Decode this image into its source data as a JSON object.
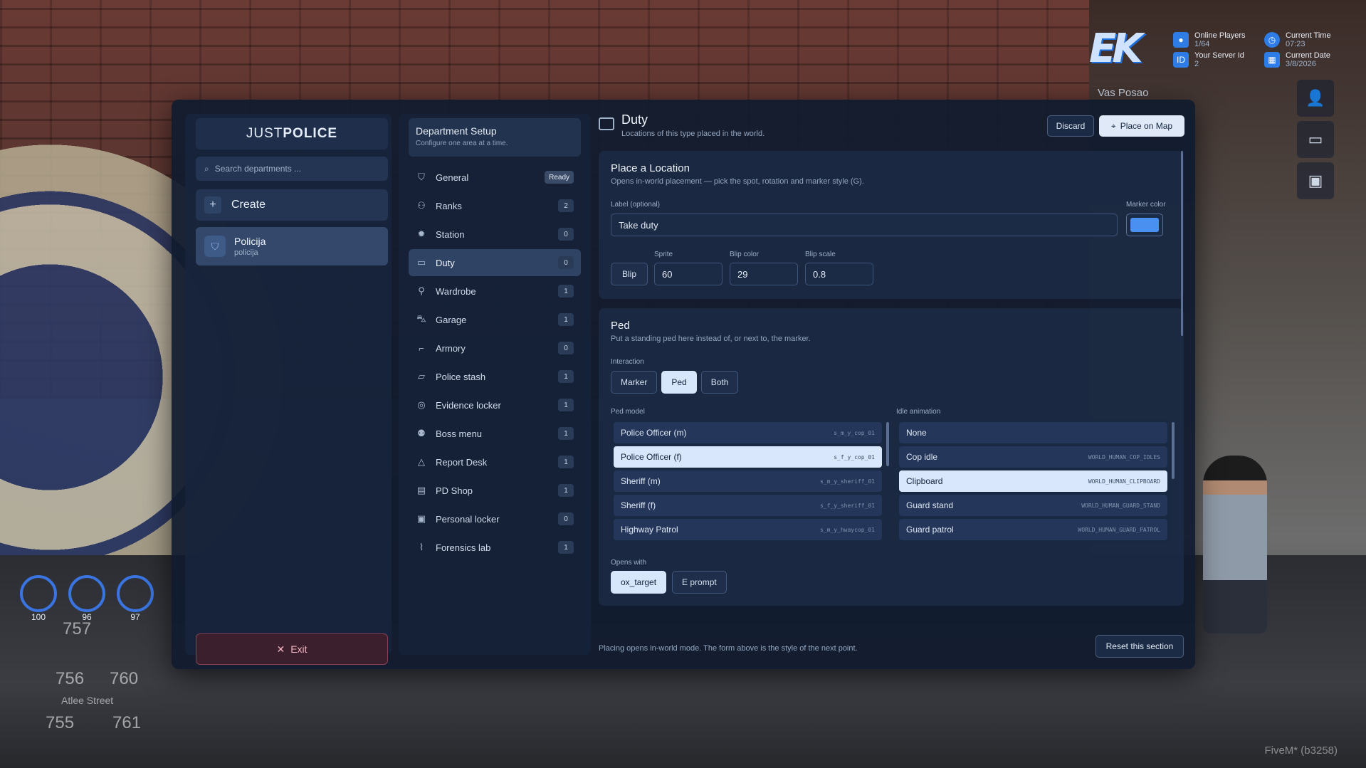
{
  "hud": {
    "online_label": "Online Players",
    "online_value": "1/64",
    "server_id_label": "Your Server Id",
    "server_id_value": "2",
    "time_label": "Current Time",
    "time_value": "07:23",
    "date_label": "Current Date",
    "date_value": "3/8/2026",
    "player_name": "Vas Posao"
  },
  "gauges": [
    "100",
    "96",
    "97"
  ],
  "minimap": {
    "street": "Atlee Street",
    "codes": [
      "757",
      "756",
      "760",
      "755",
      "761"
    ]
  },
  "fivem_tag": "FiveM* (b3258)",
  "left": {
    "brand_prefix": "JUST ",
    "brand_strong": "POLICE",
    "search_placeholder": "Search departments ...",
    "create_label": "Create",
    "department": {
      "name": "Policija",
      "slug": "policija"
    },
    "exit_label": "Exit"
  },
  "mid": {
    "title": "Department Setup",
    "subtitle": "Configure one area at a time.",
    "items": [
      {
        "label": "General",
        "count": "Ready",
        "icon": "shield-icon"
      },
      {
        "label": "Ranks",
        "count": "2",
        "icon": "users-icon"
      },
      {
        "label": "Station",
        "count": "0",
        "icon": "station-icon"
      },
      {
        "label": "Duty",
        "count": "0",
        "icon": "id-card-icon"
      },
      {
        "label": "Wardrobe",
        "count": "1",
        "icon": "shirt-icon"
      },
      {
        "label": "Garage",
        "count": "1",
        "icon": "car-icon"
      },
      {
        "label": "Armory",
        "count": "0",
        "icon": "gun-icon"
      },
      {
        "label": "Police stash",
        "count": "1",
        "icon": "folder-icon"
      },
      {
        "label": "Evidence locker",
        "count": "1",
        "icon": "fingerprint-icon"
      },
      {
        "label": "Boss menu",
        "count": "1",
        "icon": "boss-icon"
      },
      {
        "label": "Report Desk",
        "count": "1",
        "icon": "warning-icon"
      },
      {
        "label": "PD Shop",
        "count": "1",
        "icon": "shop-icon"
      },
      {
        "label": "Personal locker",
        "count": "0",
        "icon": "locker-icon"
      },
      {
        "label": "Forensics lab",
        "count": "1",
        "icon": "dropper-icon"
      }
    ]
  },
  "right": {
    "title": "Duty",
    "subtitle": "Locations of this type placed in the world.",
    "discard_label": "Discard",
    "place_label": "Place on Map",
    "place_location": {
      "title": "Place a Location",
      "desc": "Opens in-world placement — pick the spot, rotation and marker style (G).",
      "label_caption": "Label (optional)",
      "label_value": "Take duty",
      "marker_color_caption": "Marker color",
      "marker_color": "#4a90f0",
      "blip_label": "Blip",
      "sprite_caption": "Sprite",
      "sprite_value": "60",
      "blip_color_caption": "Blip color",
      "blip_color_value": "29",
      "blip_scale_caption": "Blip scale",
      "blip_scale_value": "0.8"
    },
    "ped": {
      "title": "Ped",
      "desc": "Put a standing ped here instead of, or next to, the marker.",
      "interaction_caption": "Interaction",
      "interaction_options": [
        "Marker",
        "Ped",
        "Both"
      ],
      "interaction_selected": "Ped",
      "ped_model_caption": "Ped model",
      "ped_models": [
        {
          "name": "Police Officer (m)",
          "code": "s_m_y_cop_01"
        },
        {
          "name": "Police Officer (f)",
          "code": "s_f_y_cop_01"
        },
        {
          "name": "Sheriff (m)",
          "code": "s_m_y_sheriff_01"
        },
        {
          "name": "Sheriff (f)",
          "code": "s_f_y_sheriff_01"
        },
        {
          "name": "Highway Patrol",
          "code": "s_m_y_hwaycop_01"
        }
      ],
      "ped_model_selected": "Police Officer (f)",
      "idle_caption": "Idle animation",
      "idle_animations": [
        {
          "name": "None",
          "code": ""
        },
        {
          "name": "Cop idle",
          "code": "WORLD_HUMAN_COP_IDLES"
        },
        {
          "name": "Clipboard",
          "code": "WORLD_HUMAN_CLIPBOARD"
        },
        {
          "name": "Guard stand",
          "code": "WORLD_HUMAN_GUARD_STAND"
        },
        {
          "name": "Guard patrol",
          "code": "WORLD_HUMAN_GUARD_PATROL"
        }
      ],
      "idle_selected": "Clipboard",
      "opens_with_caption": "Opens with",
      "opens_with_options": [
        "ox_target",
        "E prompt"
      ],
      "opens_with_selected": "ox_target"
    },
    "footer_note": "Placing opens in-world mode. The form above is the style of the next point.",
    "reset_label": "Reset this section"
  },
  "colors": {
    "accent": "#d8e7fb",
    "panel": "#101b2e",
    "exit_border": "#8a4054"
  }
}
